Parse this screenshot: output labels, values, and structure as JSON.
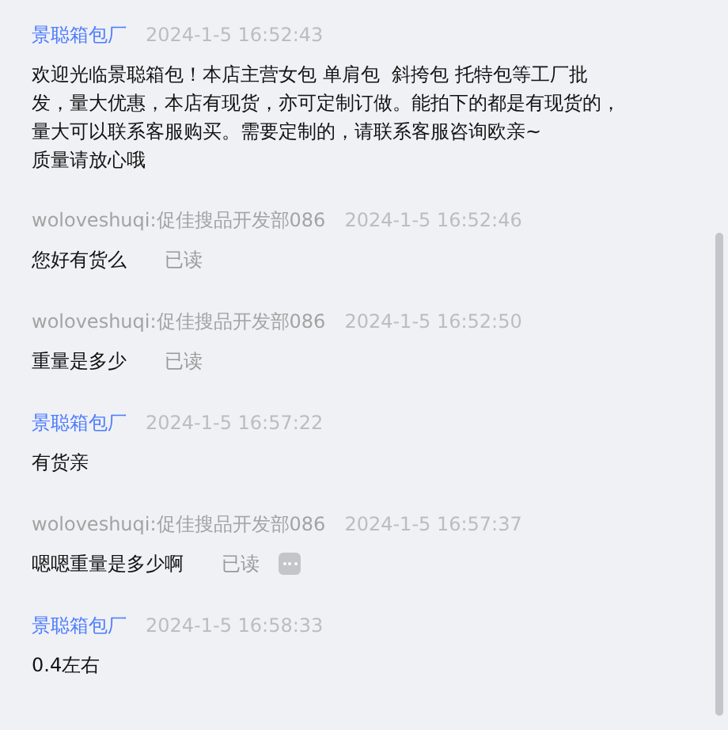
{
  "messages": [
    {
      "kind": "shop",
      "sender": "景聪箱包厂",
      "time": "2024-1-5 16:52:43",
      "text": "欢迎光临景聪箱包！本店主营女包 单肩包  斜挎包 托特包等工厂批发，量大优惠，本店有现货，亦可定制订做。能拍下的都是有现货的，量大可以联系客服购买。需要定制的，请联系客服咨询欧亲~\n质量请放心哦"
    },
    {
      "kind": "buyer",
      "sender": "woloveshuqi:促佳搜品开发部086",
      "time": "2024-1-5 16:52:46",
      "text": "您好有货么",
      "status": "已读",
      "more": false
    },
    {
      "kind": "buyer",
      "sender": "woloveshuqi:促佳搜品开发部086",
      "time": "2024-1-5 16:52:50",
      "text": "重量是多少",
      "status": "已读",
      "more": false
    },
    {
      "kind": "shop",
      "sender": "景聪箱包厂",
      "time": "2024-1-5 16:57:22",
      "text": "有货亲"
    },
    {
      "kind": "buyer",
      "sender": "woloveshuqi:促佳搜品开发部086",
      "time": "2024-1-5 16:57:37",
      "text": "嗯嗯重量是多少啊",
      "status": "已读",
      "more": true
    },
    {
      "kind": "shop",
      "sender": "景聪箱包厂",
      "time": "2024-1-5 16:58:33",
      "text": "0.4左右"
    }
  ]
}
